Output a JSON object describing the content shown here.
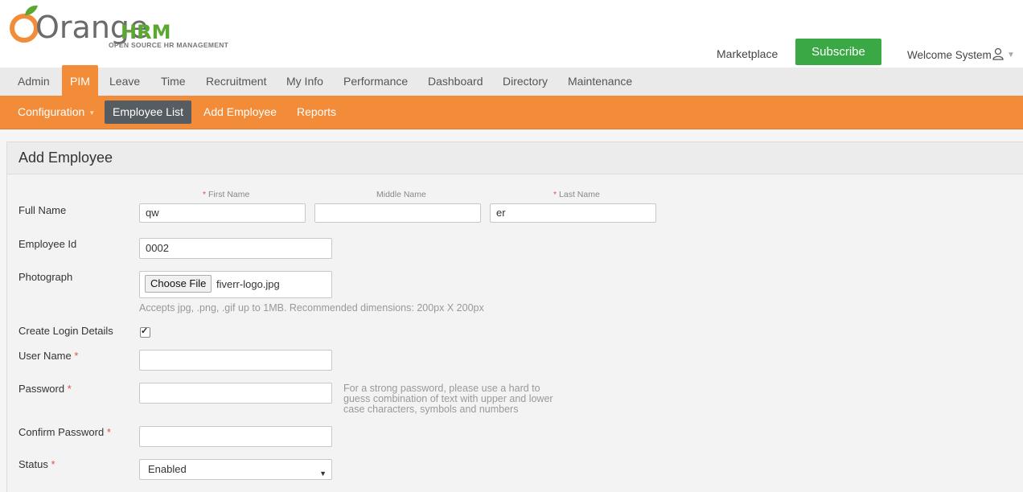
{
  "brand": {
    "logo_word": "Orange",
    "logo_suffix": "HRM",
    "tagline": "OPEN SOURCE HR MANAGEMENT"
  },
  "header": {
    "marketplace": "Marketplace",
    "subscribe": "Subscribe",
    "welcome": "Welcome System"
  },
  "main_nav": [
    {
      "label": "Admin"
    },
    {
      "label": "PIM"
    },
    {
      "label": "Leave"
    },
    {
      "label": "Time"
    },
    {
      "label": "Recruitment"
    },
    {
      "label": "My Info"
    },
    {
      "label": "Performance"
    },
    {
      "label": "Dashboard"
    },
    {
      "label": "Directory"
    },
    {
      "label": "Maintenance"
    }
  ],
  "sub_nav": [
    {
      "label": "Configuration"
    },
    {
      "label": "Employee List"
    },
    {
      "label": "Add Employee"
    },
    {
      "label": "Reports"
    }
  ],
  "form": {
    "title": "Add Employee",
    "full_name_label": "Full Name",
    "first_name_label": "First Name",
    "middle_name_label": "Middle Name",
    "last_name_label": "Last Name",
    "first_name_value": "qw",
    "middle_name_value": "",
    "last_name_value": "er",
    "employee_id_label": "Employee Id",
    "employee_id_value": "0002",
    "photograph_label": "Photograph",
    "choose_file": "Choose File",
    "file_name": "fiverr-logo.jpg",
    "photo_hint": "Accepts jpg, .png, .gif up to 1MB. Recommended dimensions: 200px X 200px",
    "create_login_label": "Create Login Details",
    "create_login_checked": true,
    "username_label": "User Name",
    "username_value": "",
    "password_label": "Password",
    "password_value": "",
    "password_hint_1": "For a strong password, please use a hard to",
    "password_hint_2": "guess combination of text with upper and lower",
    "password_hint_3": "case characters, symbols and numbers",
    "confirm_password_label": "Confirm Password",
    "confirm_password_value": "",
    "status_label": "Status",
    "status_value": "Enabled",
    "required_mark": "*"
  },
  "colors": {
    "accent_orange": "#f28c38",
    "subscribe_green": "#3aa945",
    "active_sub_item": "#555d62",
    "required_red": "#d9534f"
  }
}
